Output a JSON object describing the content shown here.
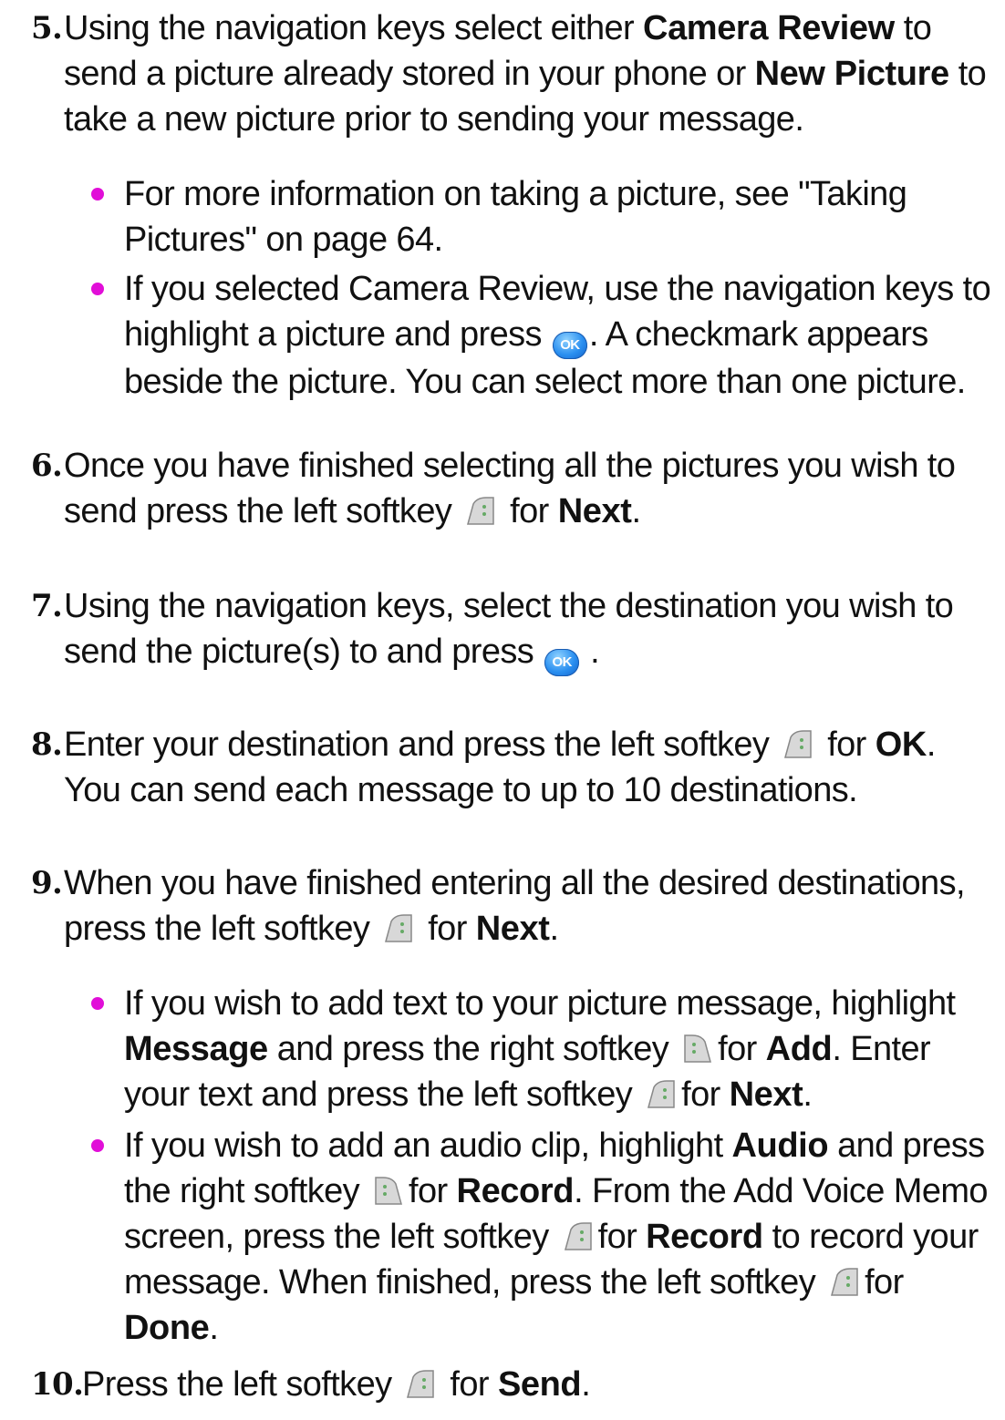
{
  "steps": [
    {
      "num": "5.",
      "segments": [
        "Using the navigation keys select either ",
        "Camera Review",
        " to send a picture already stored in your phone or ",
        "New Picture",
        " to take a new picture prior to sending your message."
      ]
    },
    {
      "num": "6.",
      "segments": [
        "Once you have finished selecting all the pictures you wish to send press the left softkey ",
        "",
        " for ",
        "Next",
        "."
      ]
    },
    {
      "num": "7.",
      "segments": [
        "Using the navigation keys, select the destination you wish to send the picture(s) to and press ",
        "",
        " ."
      ]
    },
    {
      "num": "8.",
      "segments": [
        "Enter your destination and press the left softkey ",
        "",
        " for ",
        "OK",
        ". You can send each message to up to 10 destinations."
      ]
    },
    {
      "num": "9.",
      "segments": [
        " When you have finished entering all the desired destinations, press the left softkey ",
        "",
        " for ",
        "Next",
        "."
      ]
    },
    {
      "num": "10.",
      "segments": [
        "Press the left softkey ",
        "",
        " for ",
        "Send",
        "."
      ]
    }
  ],
  "bullets": {
    "b5a": [
      "For more information on taking a picture, see \"Taking Pictures\" on page 64."
    ],
    "b5b": [
      "If you selected Camera Review, use the navigation keys to highlight a picture and press ",
      ". A checkmark appears beside the picture. You can select more than one picture."
    ],
    "b9a": [
      "If you wish to add text to your picture message, highlight ",
      "Message",
      " and press the right softkey ",
      "for ",
      "Add",
      ". Enter your text and press the left softkey ",
      "for ",
      "Next",
      "."
    ],
    "b9b": [
      "If you wish to add an audio clip, highlight ",
      "Audio",
      " and press the right softkey ",
      "for ",
      "Record",
      ". From the Add Voice Memo screen, press the left softkey ",
      "for ",
      "Record",
      " to record your message. When finished, press the left softkey ",
      "for ",
      "Done",
      "."
    ]
  },
  "icons": {
    "ok_label": "OK"
  },
  "colors": {
    "bullet": "#e10ed8",
    "ok_button": "#2a8ff0"
  }
}
